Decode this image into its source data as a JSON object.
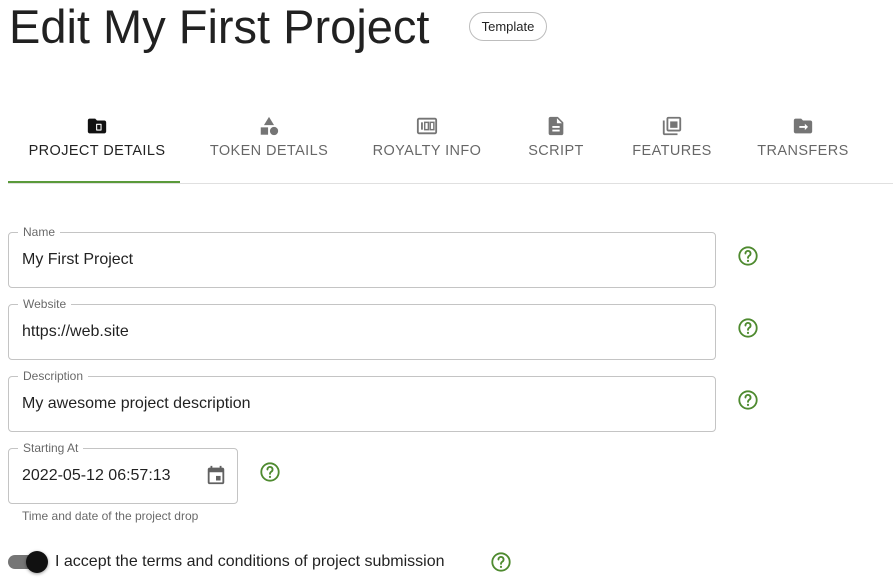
{
  "page": {
    "title": "Edit My First Project",
    "template_chip": "Template"
  },
  "tabs": [
    {
      "label": "PROJECT DETAILS",
      "icon": "folder-doc-icon",
      "active": true
    },
    {
      "label": "TOKEN DETAILS",
      "icon": "shapes-icon",
      "active": false
    },
    {
      "label": "ROYALTY INFO",
      "icon": "hundred-icon",
      "active": false
    },
    {
      "label": "SCRIPT",
      "icon": "document-icon",
      "active": false
    },
    {
      "label": "FEATURES",
      "icon": "library-icon",
      "active": false
    },
    {
      "label": "TRANSFERS",
      "icon": "folder-arrow-icon",
      "active": false
    }
  ],
  "form": {
    "name": {
      "label": "Name",
      "value": "My First Project"
    },
    "website": {
      "label": "Website",
      "value": "https://web.site"
    },
    "description": {
      "label": "Description",
      "value": "My awesome project description"
    },
    "starting_at": {
      "label": "Starting At",
      "value": "2022-05-12 06:57:13",
      "helper": "Time and date of the project drop"
    },
    "terms": {
      "label": "I accept the terms and conditions of project submission",
      "checked": true
    }
  },
  "colors": {
    "accent": "#5a9a3a",
    "help_icon": "#4e8a2f"
  }
}
